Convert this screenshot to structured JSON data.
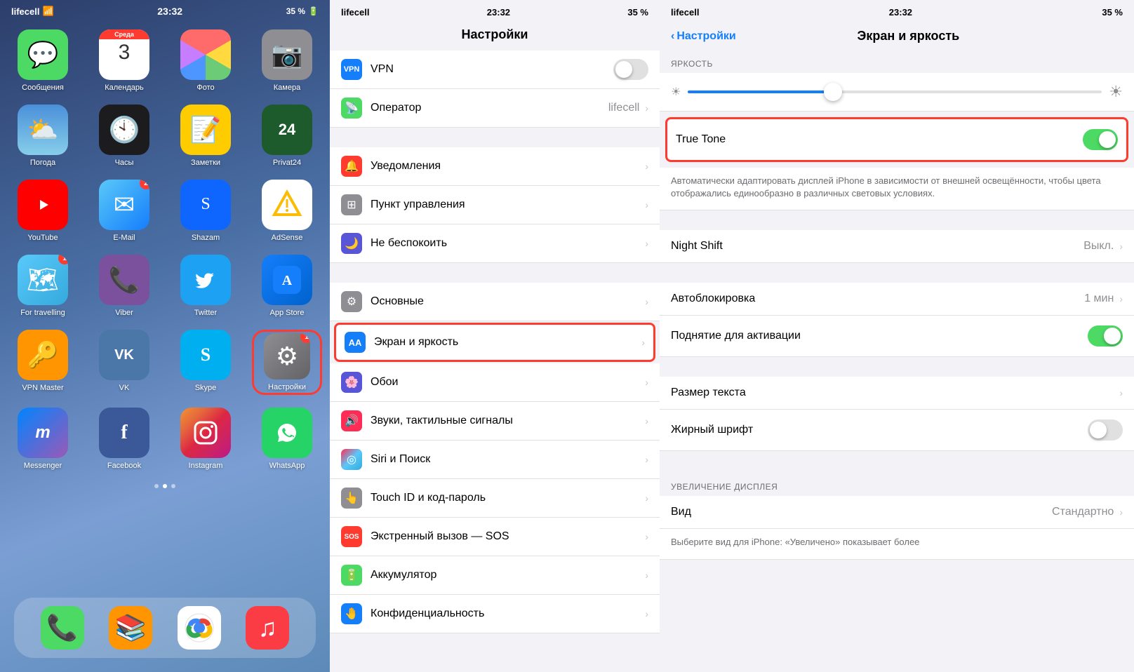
{
  "panel1": {
    "statusBar": {
      "carrier": "lifecell",
      "signal": "📶",
      "wifi": "🛜",
      "time": "23:32",
      "battery": "35 %"
    },
    "apps": [
      {
        "id": "messages",
        "label": "Сообщения",
        "color": "app-messages",
        "icon": "💬",
        "badge": null
      },
      {
        "id": "calendar",
        "label": "Календарь",
        "color": "app-calendar",
        "icon": "cal",
        "badge": null
      },
      {
        "id": "photos",
        "label": "Фото",
        "color": "app-photos",
        "icon": "🖼",
        "badge": null
      },
      {
        "id": "camera",
        "label": "Камера",
        "color": "app-camera",
        "icon": "📷",
        "badge": null
      },
      {
        "id": "weather",
        "label": "Погода",
        "color": "app-weather",
        "icon": "⛅",
        "badge": null
      },
      {
        "id": "clock",
        "label": "Часы",
        "color": "app-clock",
        "icon": "🕙",
        "badge": null
      },
      {
        "id": "notes",
        "label": "Заметки",
        "color": "app-notes",
        "icon": "📝",
        "badge": null
      },
      {
        "id": "privat24",
        "label": "Privat24",
        "color": "app-privat24",
        "icon": "24",
        "badge": null
      },
      {
        "id": "youtube",
        "label": "YouTube",
        "color": "app-youtube",
        "icon": "▶",
        "badge": null
      },
      {
        "id": "email",
        "label": "E-Mail",
        "color": "app-email",
        "icon": "✉",
        "badge": "2"
      },
      {
        "id": "shazam",
        "label": "Shazam",
        "color": "app-shazam",
        "icon": "♪",
        "badge": null
      },
      {
        "id": "adsense",
        "label": "AdSense",
        "color": "app-adsense",
        "icon": "▲",
        "badge": null
      },
      {
        "id": "maps",
        "label": "For travelling",
        "color": "app-maps",
        "icon": "🗺",
        "badge": "1"
      },
      {
        "id": "viber",
        "label": "Viber",
        "color": "app-viber",
        "icon": "📞",
        "badge": null
      },
      {
        "id": "twitter",
        "label": "Twitter",
        "color": "app-twitter",
        "icon": "🐦",
        "badge": null
      },
      {
        "id": "appstore",
        "label": "App Store",
        "color": "app-appstore",
        "icon": "A",
        "badge": null
      },
      {
        "id": "vpnmaster",
        "label": "VPN Master",
        "color": "app-vpn",
        "icon": "🔑",
        "badge": null
      },
      {
        "id": "vk",
        "label": "VK",
        "color": "app-vk",
        "icon": "VK",
        "badge": null
      },
      {
        "id": "skype",
        "label": "Skype",
        "color": "app-skype",
        "icon": "S",
        "badge": null
      },
      {
        "id": "settings",
        "label": "Настройки",
        "color": "app-settings",
        "icon": "⚙",
        "badge": "1",
        "highlight": true
      },
      {
        "id": "messenger",
        "label": "Messenger",
        "color": "app-messenger",
        "icon": "m",
        "badge": null
      },
      {
        "id": "facebook",
        "label": "Facebook",
        "color": "app-facebook",
        "icon": "f",
        "badge": null
      },
      {
        "id": "instagram",
        "label": "Instagram",
        "color": "app-instagram",
        "icon": "◉",
        "badge": null
      },
      {
        "id": "whatsapp",
        "label": "WhatsApp",
        "color": "app-whatsapp",
        "icon": "📱",
        "badge": null
      }
    ],
    "dock": [
      {
        "id": "phone",
        "icon": "📞",
        "color": "#4cd964"
      },
      {
        "id": "books",
        "icon": "📚",
        "color": "#ff9500"
      },
      {
        "id": "chrome",
        "icon": "◎",
        "color": "#4285f4"
      },
      {
        "id": "music",
        "icon": "♫",
        "color": "#fc3c44"
      }
    ],
    "calDay": "3",
    "calWeekday": "Среда"
  },
  "panel2": {
    "statusBar": {
      "carrier": "lifecell",
      "time": "23:32",
      "battery": "35 %"
    },
    "title": "Настройки",
    "items": [
      {
        "id": "vpn",
        "label": "VPN",
        "value": "",
        "iconColor": "#147efb",
        "iconText": "VPN",
        "hasToggle": true
      },
      {
        "id": "operator",
        "label": "Оператор",
        "value": "lifecell",
        "iconColor": "#4cd964",
        "iconText": "📡"
      },
      {
        "id": "notifications",
        "label": "Уведомления",
        "value": "",
        "iconColor": "#ff3b30",
        "iconText": "🔔"
      },
      {
        "id": "control",
        "label": "Пункт управления",
        "value": "",
        "iconColor": "#8e8e93",
        "iconText": "⊞"
      },
      {
        "id": "dnd",
        "label": "Не беспокоить",
        "value": "",
        "iconColor": "#5856d6",
        "iconText": "🌙"
      },
      {
        "id": "general",
        "label": "Основные",
        "value": "",
        "iconColor": "#8e8e93",
        "iconText": "⚙"
      },
      {
        "id": "display",
        "label": "Экран и яркость",
        "value": "",
        "iconColor": "#147efb",
        "iconText": "AA",
        "highlighted": true
      },
      {
        "id": "wallpaper",
        "label": "Обои",
        "value": "",
        "iconColor": "#5856d6",
        "iconText": "🌸"
      },
      {
        "id": "sounds",
        "label": "Звуки, тактильные сигналы",
        "value": "",
        "iconColor": "#ff2d55",
        "iconText": "🔊"
      },
      {
        "id": "siri",
        "label": "Siri и Поиск",
        "value": "",
        "iconColor": "#000",
        "iconText": "◎"
      },
      {
        "id": "touchid",
        "label": "Touch ID и код-пароль",
        "value": "",
        "iconColor": "#8e8e93",
        "iconText": "👆"
      },
      {
        "id": "sos",
        "label": "Экстренный вызов — SOS",
        "value": "",
        "iconColor": "#ff3b30",
        "iconText": "SOS"
      },
      {
        "id": "battery",
        "label": "Аккумулятор",
        "value": "",
        "iconColor": "#4cd964",
        "iconText": "🔋"
      },
      {
        "id": "privacy",
        "label": "Конфиденциальность",
        "value": "",
        "iconColor": "#147efb",
        "iconText": "🤚"
      }
    ]
  },
  "panel3": {
    "statusBar": {
      "carrier": "lifecell",
      "time": "23:32",
      "battery": "35 %"
    },
    "backLabel": "Настройки",
    "title": "Экран и яркость",
    "sections": {
      "brightness": {
        "label": "ЯРКОСТЬ",
        "sliderPercent": 35
      },
      "trueTone": {
        "label": "True Tone",
        "enabled": true,
        "description": "Автоматически адаптировать дисплей iPhone в зависимости от внешней освещённости, чтобы цвета отображались единообразно в различных световых условиях."
      },
      "nightShift": {
        "label": "Night Shift",
        "value": "Выкл."
      },
      "autolockLabel": "Автоблокировка",
      "autolockValue": "1 мин",
      "raiseLabel": "Поднятие для активации",
      "raiseEnabled": true,
      "textSizeLabel": "Размер текста",
      "boldTextLabel": "Жирный шрифт",
      "boldTextEnabled": false,
      "zoomSectionLabel": "УВЕЛИЧЕНИЕ ДИСПЛЕЯ",
      "viewLabel": "Вид",
      "viewValue": "Стандартно",
      "viewDesc": "Выберите вид для iPhone: «Увеличено» показывает более"
    }
  }
}
